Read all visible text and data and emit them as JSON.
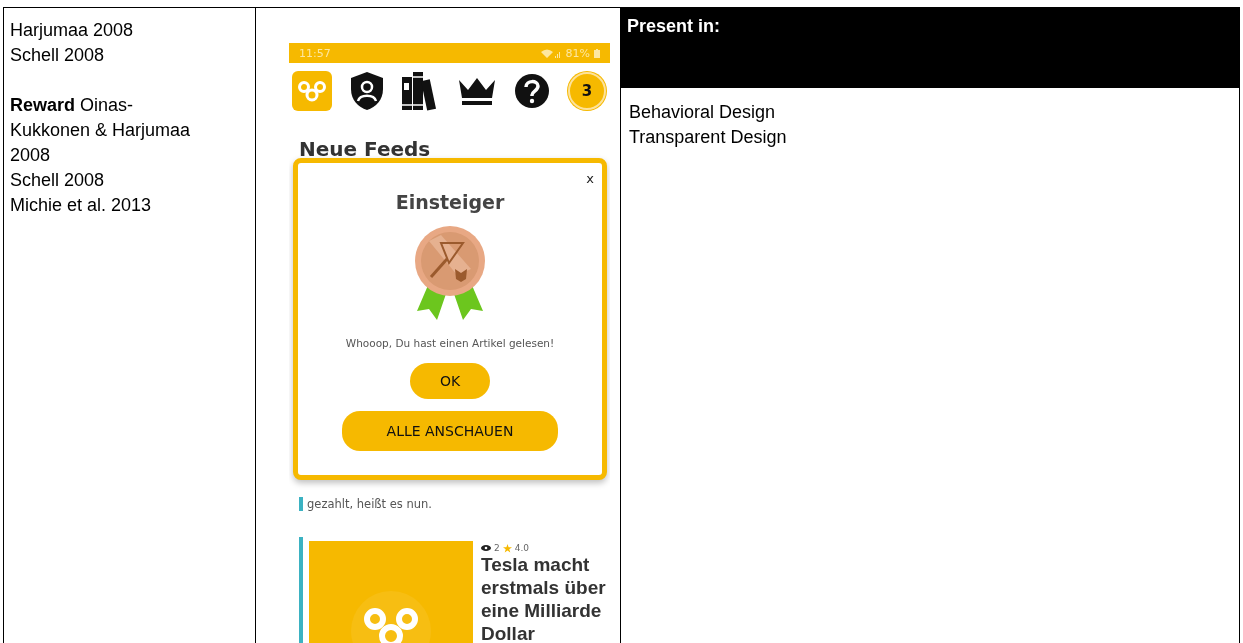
{
  "left_cell": {
    "lines": [
      "Harjumaa 2008",
      "Schell 2008"
    ],
    "reward_paragraph": {
      "term": "Reward",
      "lines": [
        "Oinas-",
        "Kukkonen & Harjumaa",
        "2008",
        "Schell 2008",
        "Michie et al. 2013"
      ]
    }
  },
  "phone": {
    "status_bar": {
      "time": "11:57",
      "battery": "81%"
    },
    "toolbar": {
      "badge": "3"
    },
    "heading": "Neue Feeds",
    "partial_text": "gezahlt, heißt es nun.",
    "article": {
      "views": "2",
      "rating": "4.0",
      "title": "Tesla macht erstmals über eine Milliarde Dollar"
    },
    "dialog": {
      "close": "x",
      "title": "Einsteiger",
      "message": "Whooop, Du hast einen Artikel gelesen!",
      "buttons": [
        "OK",
        "ALLE ANSCHAUEN"
      ]
    }
  },
  "right_cell": {
    "header": "Present in:",
    "items": [
      "Behavioral Design",
      "Transparent Design"
    ]
  }
}
